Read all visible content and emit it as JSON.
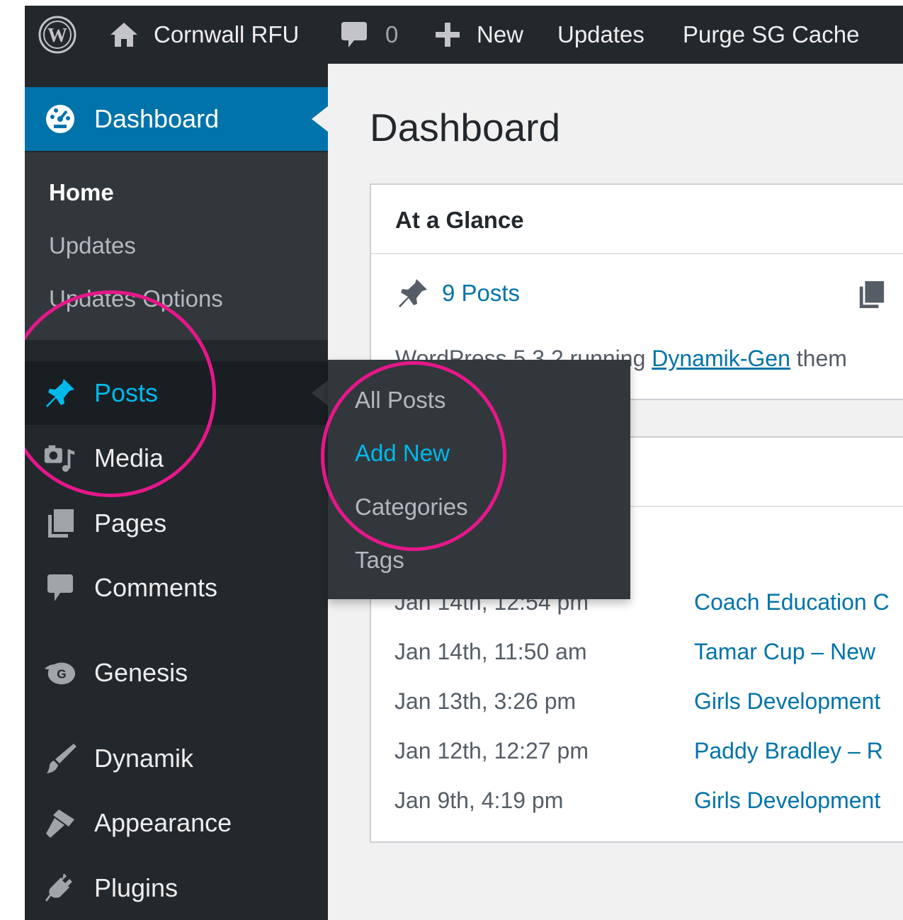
{
  "admin_bar": {
    "site_name": "Cornwall RFU",
    "comment_count": "0",
    "new_label": "New",
    "updates_label": "Updates",
    "purge_label": "Purge SG Cache"
  },
  "sidebar": {
    "dashboard_label": "Dashboard",
    "dashboard_submenu": [
      "Home",
      "Updates",
      "Updates Options"
    ],
    "items": {
      "posts": "Posts",
      "media": "Media",
      "pages": "Pages",
      "comments": "Comments",
      "genesis": "Genesis",
      "dynamik": "Dynamik",
      "appearance": "Appearance",
      "plugins": "Plugins"
    }
  },
  "posts_flyout": [
    "All Posts",
    "Add New",
    "Categories",
    "Tags"
  ],
  "page": {
    "title": "Dashboard",
    "at_a_glance": {
      "title": "At a Glance",
      "posts_count": "9 Posts",
      "version_prefix": "WordPress 5.3.2 running ",
      "theme_link": "Dynamik-Gen",
      "theme_suffix": " them"
    },
    "activity": [
      {
        "date": "Jan 14th, 12:54 pm",
        "title": "Coach Education C"
      },
      {
        "date": "Jan 14th, 11:50 am",
        "title": "Tamar Cup – New"
      },
      {
        "date": "Jan 13th, 3:26 pm",
        "title": "Girls Development"
      },
      {
        "date": "Jan 12th, 12:27 pm",
        "title": "Paddy Bradley – R"
      },
      {
        "date": "Jan 9th, 4:19 pm",
        "title": "Girls Development"
      }
    ]
  },
  "colors": {
    "admin_dark": "#23282d",
    "submenu_bg": "#32373c",
    "accent_blue": "#0073aa",
    "hover_blue": "#00b9eb",
    "highlight_pink": "#e6178a"
  }
}
